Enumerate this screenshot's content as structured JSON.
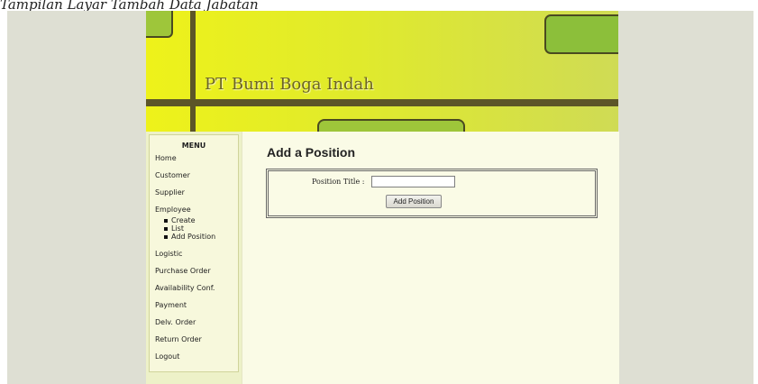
{
  "caption": "Tampilan Layar Tambah Data Jabatan",
  "site": {
    "title": "PT Bumi Boga Indah"
  },
  "sidebar": {
    "heading": "MENU",
    "items": [
      {
        "label": "Home"
      },
      {
        "label": "Customer"
      },
      {
        "label": "Supplier"
      },
      {
        "label": "Employee",
        "sub": [
          "Create",
          "List",
          "Add Position"
        ]
      },
      {
        "label": "Logistic"
      },
      {
        "label": "Purchase Order"
      },
      {
        "label": "Availability Conf."
      },
      {
        "label": "Payment"
      },
      {
        "label": "Delv. Order"
      },
      {
        "label": "Return Order"
      },
      {
        "label": "Logout"
      }
    ]
  },
  "main": {
    "page_title": "Add a Position",
    "form": {
      "field_label": "Position Title :",
      "field_value": "",
      "submit_label": "Add Position"
    }
  },
  "colors": {
    "banner_start": "#eef21a",
    "banner_end": "#cfdb55",
    "bar": "#5c5528",
    "deco_green": "#8cbf3a",
    "content_bg": "#fafbe6",
    "sidebar_bg": "#edf1c8",
    "frame_bg": "#dedfd3"
  }
}
